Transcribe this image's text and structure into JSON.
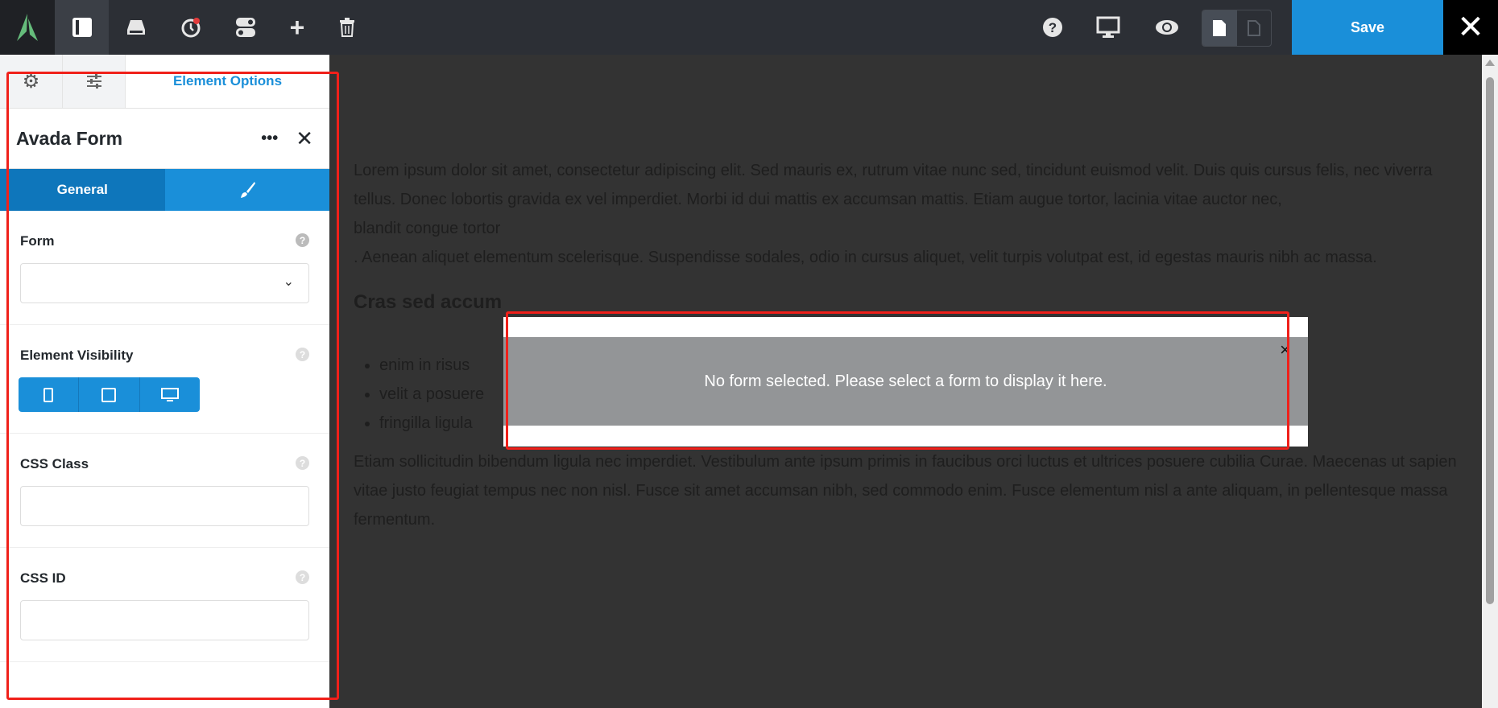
{
  "toolbar": {
    "save_label": "Save",
    "icons": [
      "avada-logo",
      "panel-toggle-icon",
      "library-icon",
      "history-icon",
      "toggle-icon",
      "add-icon",
      "trash-icon",
      "help-icon",
      "desktop-icon",
      "preview-icon",
      "page-icon",
      "page-outline-icon",
      "close-icon"
    ]
  },
  "panel": {
    "tab_active": "Element Options",
    "title": "Avada Form",
    "subtabs": {
      "general": "General"
    },
    "options": [
      {
        "label": "Form",
        "value": ""
      },
      {
        "label": "Element Visibility"
      },
      {
        "label": "CSS Class",
        "value": ""
      },
      {
        "label": "CSS ID",
        "value": ""
      }
    ],
    "help": "?"
  },
  "content": {
    "p1": "Lorem ipsum dolor sit amet, consectetur adipiscing elit. Sed mauris ex, rutrum vitae nunc sed, tincidunt euismod velit. Duis quis cursus felis, nec viverra tellus. Donec lobortis gravida ex vel imperdiet. Morbi id dui mattis ex accumsan mattis. Etiam augue tortor, lacinia vitae auctor nec,",
    "bold": "blandit congue tortor",
    "p1b": ". Aenean aliquet elementum scelerisque. Suspendisse sodales, odio in cursus aliquet, velit turpis volutpat est, id egestas mauris nibh ac massa.",
    "heading": "Cras sed accum",
    "list": [
      "enim in risus",
      "velit a posuere",
      "fringilla ligula"
    ],
    "p2": "Etiam sollicitudin bibendum ligula nec imperdiet. Vestibulum ante ipsum primis in faucibus orci luctus et ultrices posuere cubilia Curae. Maecenas ut sapien vitae justo feugiat tempus nec non nisl. Fusce sit amet accumsan nibh, sed commodo enim. Fusce elementum nisl a ante aliquam, in pellentesque massa fermentum."
  },
  "modal": {
    "message": "No form selected. Please select a form to display it here.",
    "close": "×"
  },
  "colors": {
    "accent": "#1a8fd9",
    "highlight": "#f0201a"
  }
}
